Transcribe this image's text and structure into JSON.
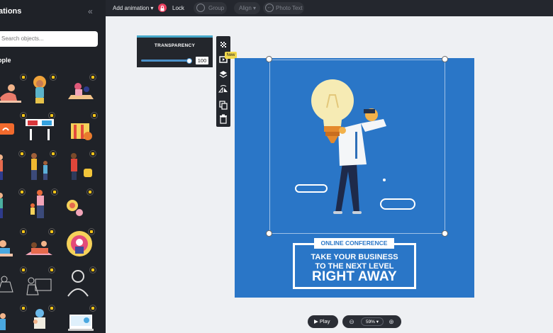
{
  "sidebar": {
    "title": "ations",
    "collapse_icon": "double-chevron-left-icon",
    "search_placeholder": "Search objects...",
    "category": "ople"
  },
  "toolbar": {
    "add_animation": "Add animation ▾",
    "lock": "Lock",
    "group": "Group",
    "align": "Align ▾",
    "photo_text": "Photo Text"
  },
  "transparency": {
    "title": "TRANSPARENCY",
    "value": "100"
  },
  "side_toolbar": {
    "new_badge": "New"
  },
  "canvas": {
    "background": "#2a76c7",
    "label": "ONLINE CONFERENCE",
    "line1": "TAKE YOUR BUSINESS",
    "line2": "TO THE NEXT LEVEL",
    "line3": "RIGHT AWAY"
  },
  "bottom": {
    "play": "Play",
    "zoom": "59%  ▾"
  }
}
